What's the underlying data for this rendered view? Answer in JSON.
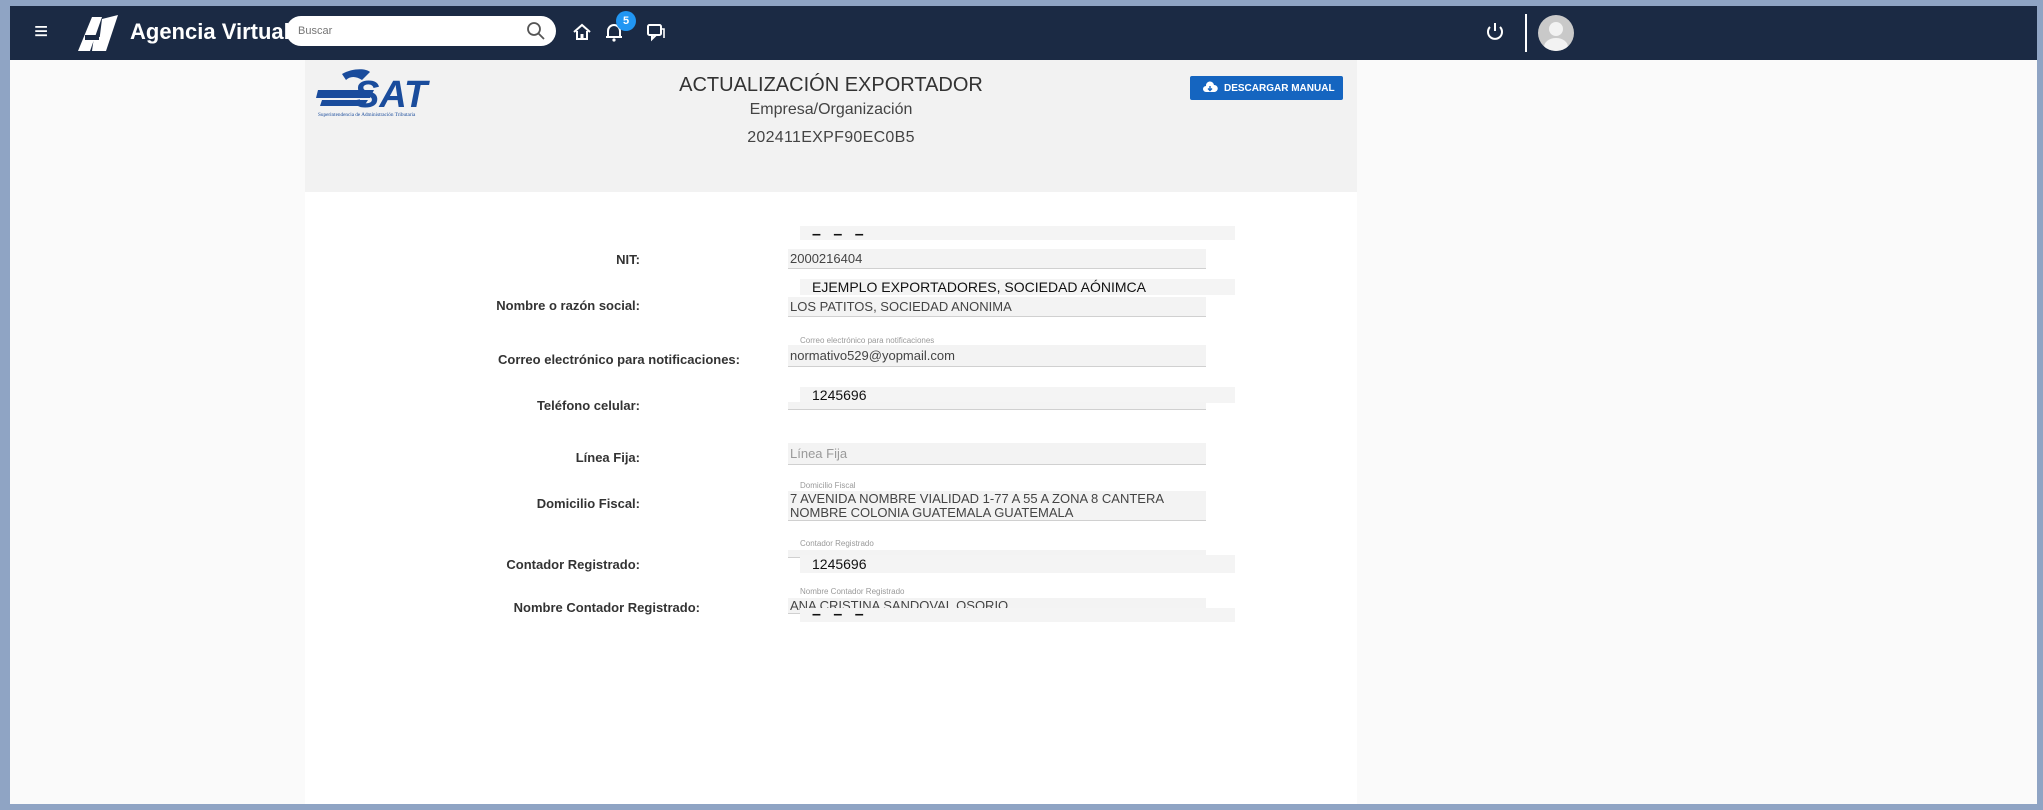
{
  "app": {
    "title": "Agencia Virtual",
    "logo": "AV"
  },
  "search": {
    "placeholder": "Buscar"
  },
  "notifications": {
    "count": "5"
  },
  "header": {
    "title": "ACTUALIZACIÓN EXPORTADOR",
    "subtitle": "Empresa/Organización",
    "code": "202411EXPF90EC0B5",
    "download_label": "DESCARGAR MANUAL",
    "logo_text": "SAT",
    "logo_caption": "Superintendencia de Administración Tributaria"
  },
  "form": {
    "top_mark": "– – –",
    "nit": {
      "label": "NIT:",
      "value": "2000216404"
    },
    "nombre": {
      "label": "Nombre o razón social:",
      "overlay": "EJEMPLO EXPORTADORES, SOCIEDAD AÓNIMCA",
      "value": "LOS PATITOS, SOCIEDAD ANONIMA"
    },
    "correo": {
      "label": "Correo electrónico para notificaciones:",
      "float_label": "Correo electrónico para notificaciones",
      "value": "normativo529@yopmail.com"
    },
    "telefono": {
      "label": "Teléfono celular:",
      "overlay": "1245696"
    },
    "linea": {
      "label": "Línea Fija:",
      "placeholder": "Línea Fija"
    },
    "domicilio": {
      "label": "Domicilio Fiscal:",
      "float_label": "Domicilio Fiscal",
      "value_line1": "7 AVENIDA NOMBRE VIALIDAD 1-77 A 55 A ZONA 8 CANTERA",
      "value_line2": "NOMBRE COLONIA GUATEMALA GUATEMALA"
    },
    "contador": {
      "label": "Contador Registrado:",
      "float_label": "Contador Registrado",
      "overlay": "1245696"
    },
    "nombre_contador": {
      "label": "Nombre Contador Registrado:",
      "float_label": "Nombre Contador Registrado",
      "value": "ANA CRISTINA SANDOVAL OSORIO"
    },
    "bottom_mark": "– – –"
  },
  "colors": {
    "topbar": "#1b2a44",
    "accent": "#1565c0",
    "badge": "#2196f3"
  },
  "icons": [
    "menu-icon",
    "av-logo-icon",
    "search-icon",
    "home-icon",
    "bell-icon",
    "chat-icon",
    "power-icon",
    "user-avatar-icon",
    "cloud-download-icon"
  ]
}
